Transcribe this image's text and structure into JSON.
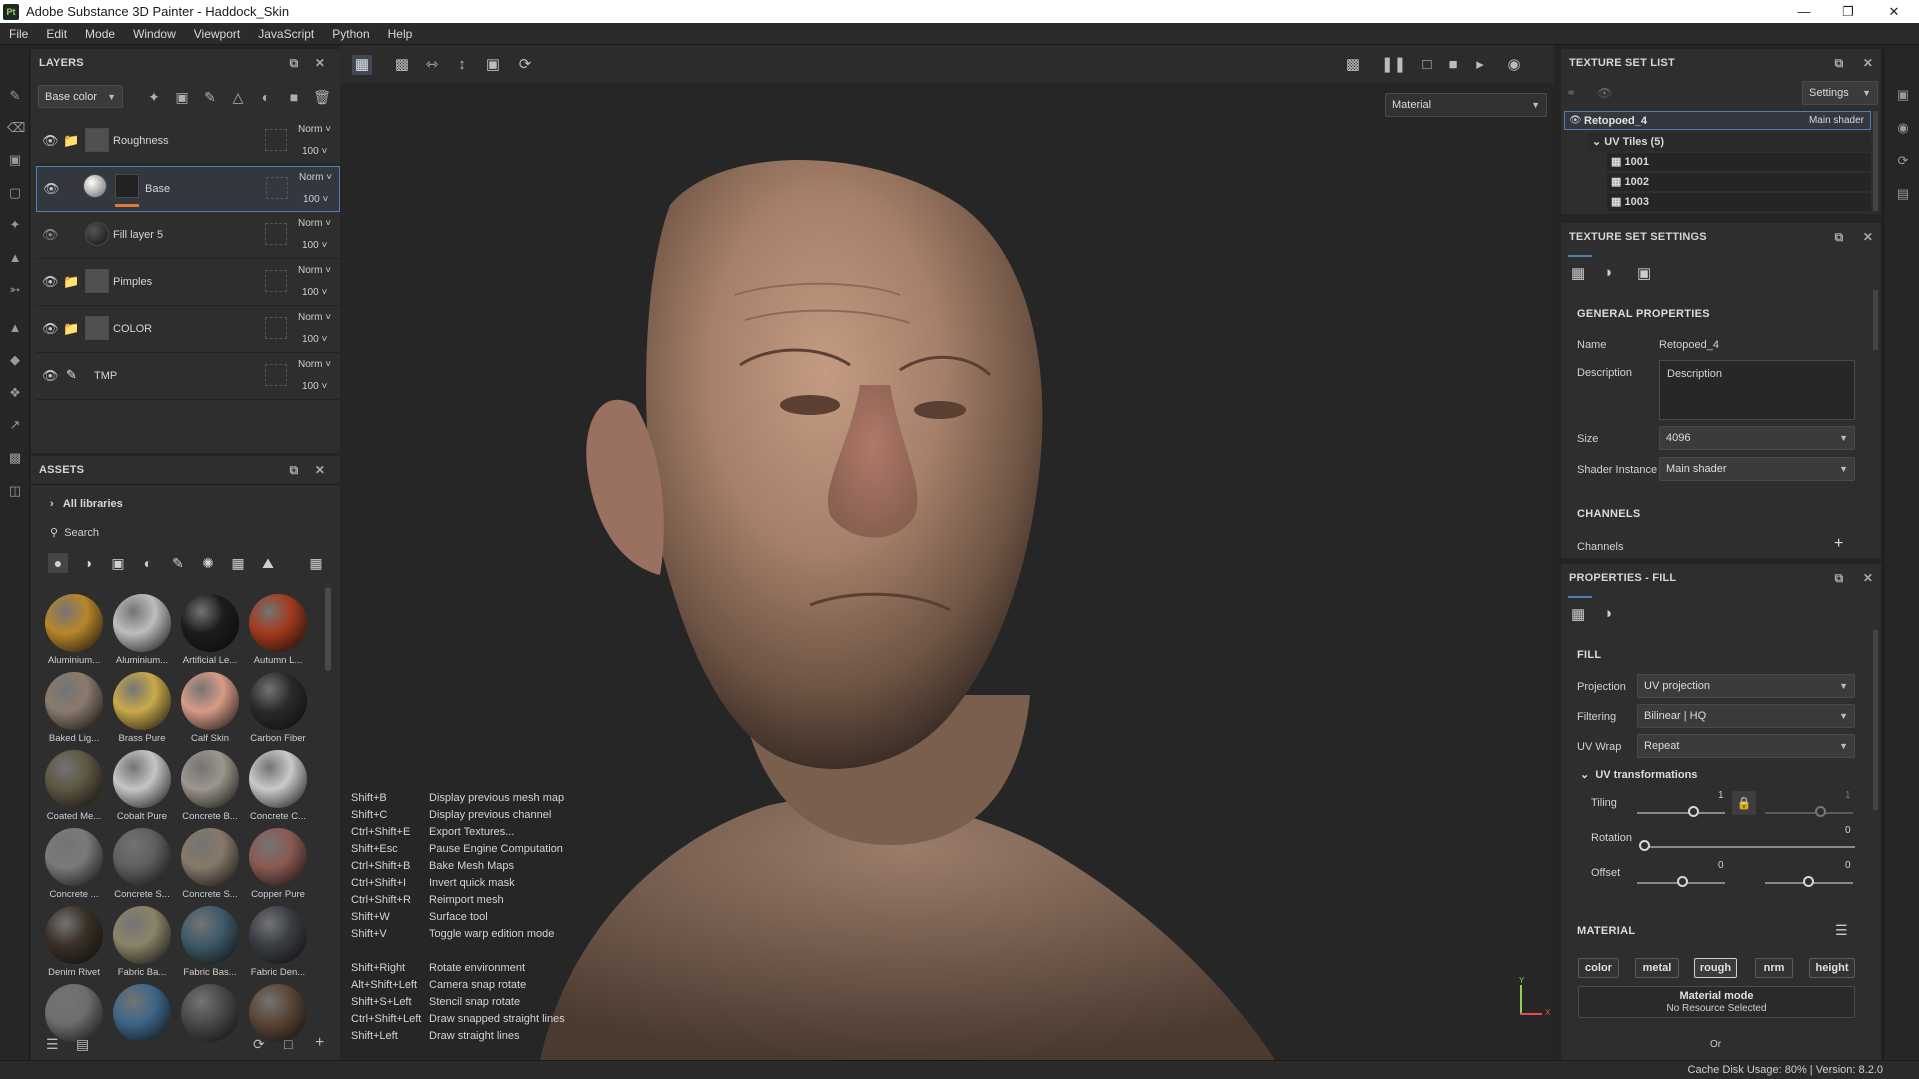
{
  "window": {
    "title": "Adobe Substance 3D Painter - Haddock_Skin",
    "logo_text": "Pt"
  },
  "menu": [
    "File",
    "Edit",
    "Mode",
    "Window",
    "Viewport",
    "JavaScript",
    "Python",
    "Help"
  ],
  "layers": {
    "title": "LAYERS",
    "channel_selector": "Base color",
    "items": [
      {
        "name": "Roughness",
        "blend": "Norm",
        "opacity": "100",
        "type": "folder",
        "visible": true
      },
      {
        "name": "Base",
        "blend": "Norm",
        "opacity": "100",
        "type": "fill",
        "visible": true,
        "selected": true
      },
      {
        "name": "Fill layer 5",
        "blend": "Norm",
        "opacity": "100",
        "type": "fill",
        "visible": false
      },
      {
        "name": "Pimples",
        "blend": "Norm",
        "opacity": "100",
        "type": "folder",
        "visible": true
      },
      {
        "name": "COLOR",
        "blend": "Norm",
        "opacity": "100",
        "type": "folder",
        "visible": true
      },
      {
        "name": "TMP",
        "blend": "Norm",
        "opacity": "100",
        "type": "paint",
        "visible": true
      }
    ]
  },
  "assets": {
    "title": "ASSETS",
    "library": "All libraries",
    "search_placeholder": "Search",
    "items": [
      {
        "label": "Aluminium...",
        "color": "#b8862a"
      },
      {
        "label": "Aluminium...",
        "color": "#bdbdbd"
      },
      {
        "label": "Artificial Le...",
        "color": "#1c1c1c"
      },
      {
        "label": "Autumn L...",
        "color": "#a23a1d"
      },
      {
        "label": "Baked Lig...",
        "color": "#8a7b6b"
      },
      {
        "label": "Brass Pure",
        "color": "#c9a94a"
      },
      {
        "label": "Calf Skin",
        "color": "#d79c86"
      },
      {
        "label": "Carbon Fiber",
        "color": "#2a2a2a"
      },
      {
        "label": "Coated Me...",
        "color": "#5e5642"
      },
      {
        "label": "Cobalt Pure",
        "color": "#c5c5c5"
      },
      {
        "label": "Concrete B...",
        "color": "#9c968c"
      },
      {
        "label": "Concrete C...",
        "color": "#c9c9c9"
      },
      {
        "label": "Concrete ...",
        "color": "#7a7a78"
      },
      {
        "label": "Concrete S...",
        "color": "#5f5f5f"
      },
      {
        "label": "Concrete S...",
        "color": "#86796a"
      },
      {
        "label": "Copper Pure",
        "color": "#8a5a52"
      },
      {
        "label": "Denim Rivet",
        "color": "#3a3026"
      },
      {
        "label": "Fabric Ba...",
        "color": "#8a8468"
      },
      {
        "label": "Fabric Bas...",
        "color": "#3e5a68"
      },
      {
        "label": "Fabric Den...",
        "color": "#3a3e44"
      },
      {
        "label": "",
        "color": "#6e6e6e"
      },
      {
        "label": "",
        "color": "#3d6688"
      },
      {
        "label": "",
        "color": "#4a4a4a"
      },
      {
        "label": "",
        "color": "#5a4536"
      }
    ]
  },
  "viewport": {
    "display_mode": "Material",
    "shortcuts": [
      {
        "key": "Shift+B",
        "action": "Display previous mesh map"
      },
      {
        "key": "Shift+C",
        "action": "Display previous channel"
      },
      {
        "key": "Ctrl+Shift+E",
        "action": "Export Textures..."
      },
      {
        "key": "Shift+Esc",
        "action": "Pause Engine Computation"
      },
      {
        "key": "Ctrl+Shift+B",
        "action": "Bake Mesh Maps"
      },
      {
        "key": "Ctrl+Shift+I",
        "action": "Invert quick mask"
      },
      {
        "key": "Ctrl+Shift+R",
        "action": "Reimport mesh"
      },
      {
        "key": "Shift+W",
        "action": "Surface tool"
      },
      {
        "key": "Shift+V",
        "action": "Toggle warp edition mode"
      },
      {
        "key": "",
        "action": ""
      },
      {
        "key": "Shift+Right",
        "action": "Rotate environment"
      },
      {
        "key": "Alt+Shift+Left",
        "action": "Camera snap rotate"
      },
      {
        "key": "Shift+S+Left",
        "action": "Stencil snap rotate"
      },
      {
        "key": "Ctrl+Shift+Left",
        "action": "Draw snapped straight lines"
      },
      {
        "key": "Shift+Left",
        "action": "Draw straight lines"
      }
    ],
    "axis_y": "Y",
    "axis_x": "X"
  },
  "texture_set_list": {
    "title": "TEXTURE SET LIST",
    "settings_label": "Settings",
    "set_name": "Retopoed_4",
    "shader": "Main shader",
    "uv_tiles_label": "UV Tiles (5)",
    "tiles": [
      "1001",
      "1002",
      "1003"
    ]
  },
  "texture_set_settings": {
    "title": "TEXTURE SET SETTINGS",
    "general": "GENERAL PROPERTIES",
    "name_label": "Name",
    "name_value": "Retopoed_4",
    "description_label": "Description",
    "description_value": "Description",
    "size_label": "Size",
    "size_value": "4096",
    "shader_label": "Shader Instance",
    "shader_value": "Main shader",
    "channels_section": "CHANNELS",
    "channels_label": "Channels"
  },
  "properties": {
    "title": "PROPERTIES - FILL",
    "fill_section": "FILL",
    "projection_label": "Projection",
    "projection_value": "UV projection",
    "filtering_label": "Filtering",
    "filtering_value": "Bilinear | HQ",
    "uvwrap_label": "UV Wrap",
    "uvwrap_value": "Repeat",
    "uvtrans_label": "UV transformations",
    "tiling_label": "Tiling",
    "tiling_value": "1",
    "tiling_value2": "1",
    "rotation_label": "Rotation",
    "rotation_value": "0",
    "offset_label": "Offset",
    "offset_value": "0",
    "offset_value2": "0",
    "material_section": "MATERIAL",
    "channel_buttons": [
      "color",
      "metal",
      "rough",
      "nrm",
      "height"
    ],
    "material_mode": "Material mode",
    "no_resource": "No Resource Selected",
    "or_label": "Or"
  },
  "status": {
    "text": "Cache Disk Usage:  80% | Version: 8.2.0"
  }
}
